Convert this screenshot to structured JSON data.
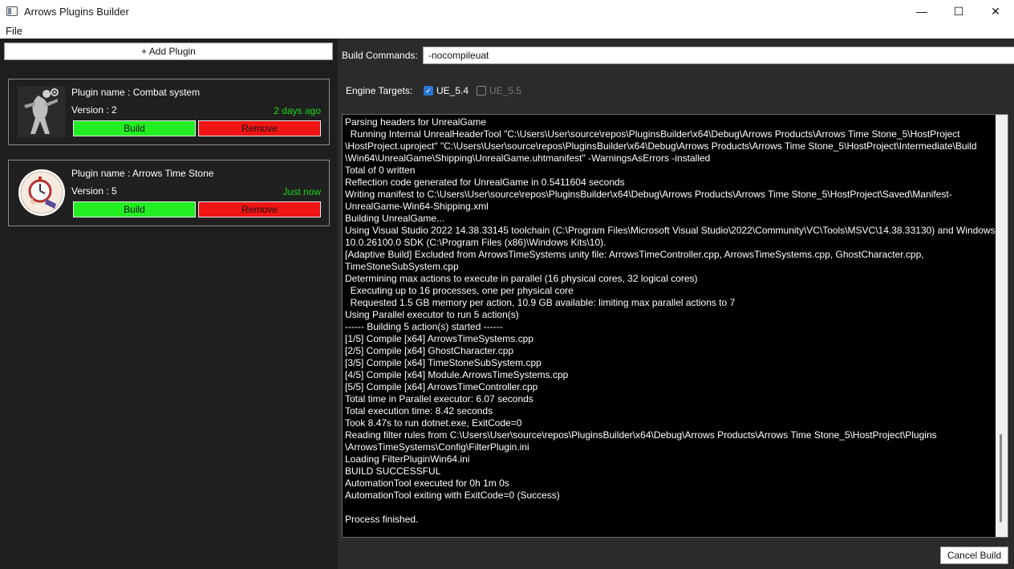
{
  "window": {
    "title": "Arrows Plugins Builder",
    "minimize_glyph": "—",
    "maximize_glyph": "☐",
    "close_glyph": "✕"
  },
  "menu": {
    "file": "File"
  },
  "sidebar": {
    "add_plugin_label": "+ Add Plugin",
    "plugins": [
      {
        "name": "Plugin name : Combat system",
        "version": "Version : 2",
        "updated": "2 days ago",
        "build_label": "Build",
        "remove_label": "Remove",
        "icon": "combat-icon"
      },
      {
        "name": "Plugin name : Arrows Time Stone",
        "version": "Version : 5",
        "updated": "Just now",
        "build_label": "Build",
        "remove_label": "Remove",
        "icon": "stopwatch-icon"
      }
    ]
  },
  "build": {
    "commands_label": "Build Commands:",
    "commands_value": "-nocompileuat",
    "targets_label": "Engine Targets:",
    "targets": [
      {
        "label": "UE_5.4",
        "checked": true
      },
      {
        "label": "UE_5.5",
        "checked": false
      }
    ],
    "cancel_label": "Cancel Build"
  },
  "console": {
    "lines": [
      "Parsing headers for UnrealGame",
      "  Running Internal UnrealHeaderTool \"C:\\Users\\User\\source\\repos\\PluginsBuilder\\x64\\Debug\\Arrows Products\\Arrows Time Stone_5\\HostProject",
      "\\HostProject.uproject\" \"C:\\Users\\User\\source\\repos\\PluginsBuilder\\x64\\Debug\\Arrows Products\\Arrows Time Stone_5\\HostProject\\Intermediate\\Build",
      "\\Win64\\UnrealGame\\Shipping\\UnrealGame.uhtmanifest\" -WarningsAsErrors -installed",
      "Total of 0 written",
      "Reflection code generated for UnrealGame in 0.5411604 seconds",
      "Writing manifest to C:\\Users\\User\\source\\repos\\PluginsBuilder\\x64\\Debug\\Arrows Products\\Arrows Time Stone_5\\HostProject\\Saved\\Manifest-",
      "UnrealGame-Win64-Shipping.xml",
      "Building UnrealGame...",
      "Using Visual Studio 2022 14.38.33145 toolchain (C:\\Program Files\\Microsoft Visual Studio\\2022\\Community\\VC\\Tools\\MSVC\\14.38.33130) and Windows",
      "10.0.26100.0 SDK (C:\\Program Files (x86)\\Windows Kits\\10).",
      "[Adaptive Build] Excluded from ArrowsTimeSystems unity file: ArrowsTimeController.cpp, ArrowsTimeSystems.cpp, GhostCharacter.cpp,",
      "TimeStoneSubSystem.cpp",
      "Determining max actions to execute in parallel (16 physical cores, 32 logical cores)",
      "  Executing up to 16 processes, one per physical core",
      "  Requested 1.5 GB memory per action, 10.9 GB available: limiting max parallel actions to 7",
      "Using Parallel executor to run 5 action(s)",
      "------ Building 5 action(s) started ------",
      "[1/5] Compile [x64] ArrowsTimeSystems.cpp",
      "[2/5] Compile [x64] GhostCharacter.cpp",
      "[3/5] Compile [x64] TimeStoneSubSystem.cpp",
      "[4/5] Compile [x64] Module.ArrowsTimeSystems.cpp",
      "[5/5] Compile [x64] ArrowsTimeController.cpp",
      "Total time in Parallel executor: 6.07 seconds",
      "Total execution time: 8.42 seconds",
      "Took 8.47s to run dotnet.exe, ExitCode=0",
      "Reading filter rules from C:\\Users\\User\\source\\repos\\PluginsBuilder\\x64\\Debug\\Arrows Products\\Arrows Time Stone_5\\HostProject\\Plugins",
      "\\ArrowsTimeSystems\\Config\\FilterPlugin.ini",
      "Loading FilterPluginWin64.ini",
      "BUILD SUCCESSFUL",
      "AutomationTool executed for 0h 1m 0s",
      "AutomationTool exiting with ExitCode=0 (Success)",
      "",
      "Process finished."
    ]
  },
  "colors": {
    "build_green": "#22ee22",
    "remove_red": "#f01414",
    "updated_green": "#1bd81b",
    "checkbox_blue": "#2a76d2"
  }
}
